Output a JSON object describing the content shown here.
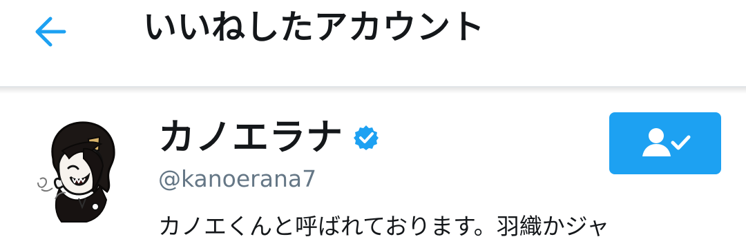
{
  "header": {
    "back_icon": "arrow-left-icon",
    "title": "いいねしたアカウント"
  },
  "account": {
    "avatar_icon": "anime-avatar-illustration",
    "display_name": "カノエラナ",
    "verified_icon": "verified-badge-icon",
    "handle": "@kanoerana7",
    "bio": "カノエくんと呼ばれております。羽織かジャ",
    "following_icon": "person-check-icon"
  },
  "colors": {
    "accent": "#1da1f2",
    "text": "#14171a",
    "secondary_text": "#657786",
    "divider": "#e2e5e8"
  }
}
